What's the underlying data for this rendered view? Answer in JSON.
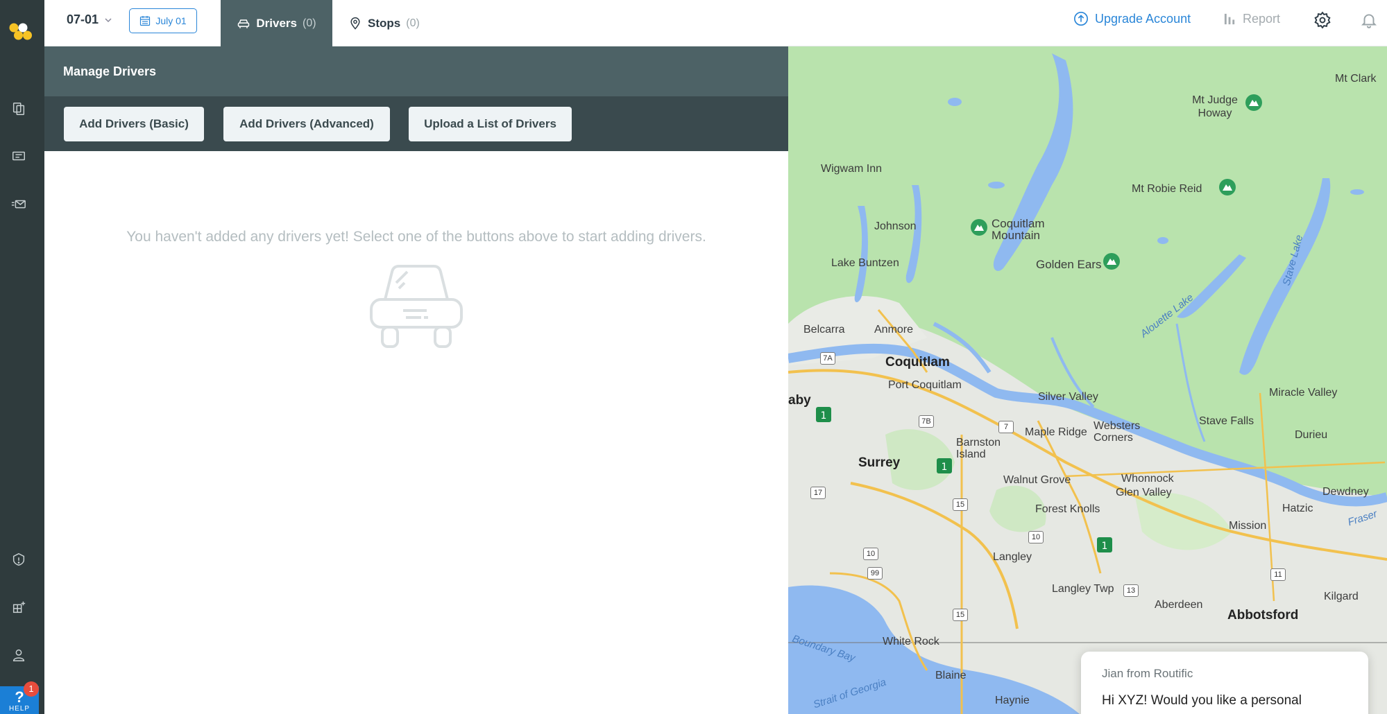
{
  "topbar": {
    "date_label": "07-01",
    "date_button": "July 01",
    "tabs": [
      {
        "label": "Drivers",
        "count": "(0)"
      },
      {
        "label": "Stops",
        "count": "(0)"
      }
    ],
    "upgrade_label": "Upgrade Account",
    "report_label": "Report"
  },
  "panel": {
    "title": "Manage Drivers",
    "buttons": [
      "Add Drivers (Basic)",
      "Add Drivers (Advanced)",
      "Upload a List of Drivers"
    ],
    "empty_message": "You haven't added any drivers yet! Select one of the buttons above to start adding drivers."
  },
  "help": {
    "label": "HELP",
    "badge": "1"
  },
  "map": {
    "places": [
      "Mt Clark",
      "Mt Judge Howay",
      "Wigwam Inn",
      "Mt Robie Reid",
      "Johnson",
      "Coquitlam Mountain",
      "Lake Buntzen",
      "Golden Ears",
      "Belcarra",
      "Anmore",
      "Coquitlam",
      "Port Coquitlam",
      "Silver Valley",
      "Miracle Valley",
      "aby",
      "Stave Falls",
      "Maple Ridge",
      "Websters Corners",
      "Durieu",
      "Barnston Island",
      "Surrey",
      "Walnut Grove",
      "Whonnock",
      "Glen Valley",
      "Dewdney",
      "Forest Knolls",
      "Hatzic",
      "Mission",
      "Langley",
      "Langley Twp",
      "Aberdeen",
      "Abbotsford",
      "Kilgard",
      "White Rock",
      "Blaine",
      "Haynie"
    ],
    "water": [
      "Alouette Lake",
      "Stave Lake",
      "Fraser",
      "Boundary Bay",
      "Strait of Georgia"
    ],
    "highways": [
      "7A",
      "7B",
      "7",
      "15",
      "17",
      "10",
      "99",
      "13",
      "11"
    ]
  },
  "chat": {
    "from": "Jian from Routific",
    "message": "Hi XYZ! Would you like a personal"
  },
  "colors": {
    "rail": "#2f3b3d",
    "panel_header": "#4d6266",
    "panel_toolbar": "#3a4a4e",
    "accent": "#2a86d8",
    "map_land": "#b9e3ad",
    "map_water": "#8fb9f0",
    "urban": "#e6e8e3"
  }
}
